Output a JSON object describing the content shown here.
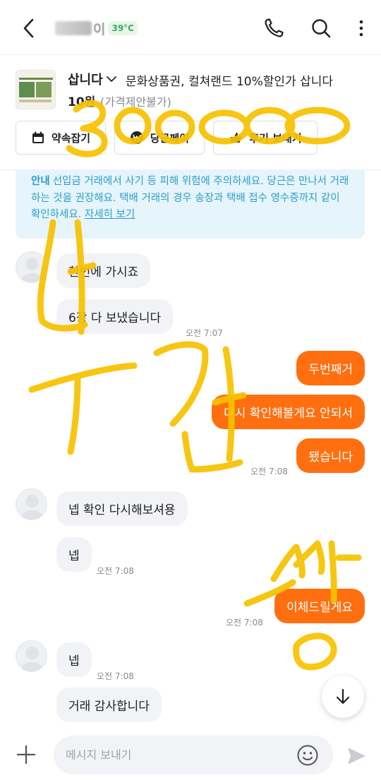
{
  "header": {
    "user_name_suffix": "이",
    "temperature": "39°C",
    "icons": {
      "back": "back-arrow-icon",
      "phone": "phone-icon",
      "search": "search-icon",
      "more": "more-vertical-icon"
    }
  },
  "product": {
    "status": "삽니다",
    "title": "문화상품권, 컬쳐랜드 10%할인가 삽니다",
    "price": "10원",
    "negotiation": "(가격제안불가)",
    "actions": [
      {
        "label": "약속잡기",
        "icon": "calendar-icon"
      },
      {
        "label": "당근페이",
        "icon": "won-coin-icon"
      },
      {
        "label": "후기 보내기",
        "icon": "review-icon"
      }
    ]
  },
  "notice": {
    "tag": "안내",
    "text": "선입금 거래에서 사기 등 피해 위험에 주의하세요. 당근은 만나서 거래하는 것을 권장해요. 택배 거래의 경우 송장과 택배 접수 영수증까지 같이 확인하세요.",
    "link": "자세히 보기"
  },
  "messages": [
    {
      "side": "in",
      "text": "한번에 가시죠"
    },
    {
      "side": "in",
      "text": "6장 다 보냈습니다",
      "time": "오전 7:07"
    },
    {
      "side": "out",
      "text": "두번째거"
    },
    {
      "side": "out",
      "text": "다시 확인해볼게요 안되서"
    },
    {
      "side": "out",
      "text": "됐습니다",
      "time": "오전 7:08"
    },
    {
      "side": "in",
      "text": "넵 확인 다시해보셔용"
    },
    {
      "side": "in",
      "text": "넵",
      "time": "오전 7:08"
    },
    {
      "side": "out",
      "text": "이체드릴게요",
      "time": "오전 7:08"
    },
    {
      "side": "in",
      "text": "넵",
      "time": "오전 7:08"
    },
    {
      "side": "in",
      "text": "거래 감사합니다"
    }
  ],
  "input": {
    "placeholder": "메시지 보내기",
    "icons": {
      "plus": "plus-icon",
      "emoji": "emoji-icon",
      "send": "send-icon",
      "scroll": "arrow-down-icon"
    }
  },
  "colors": {
    "brand_orange": "#ff6f0f",
    "notice_bg": "#e6f4fb",
    "notice_text": "#2a9fc9",
    "incoming_bubble": "#f2f3f6",
    "handwriting": "#f7c200"
  }
}
